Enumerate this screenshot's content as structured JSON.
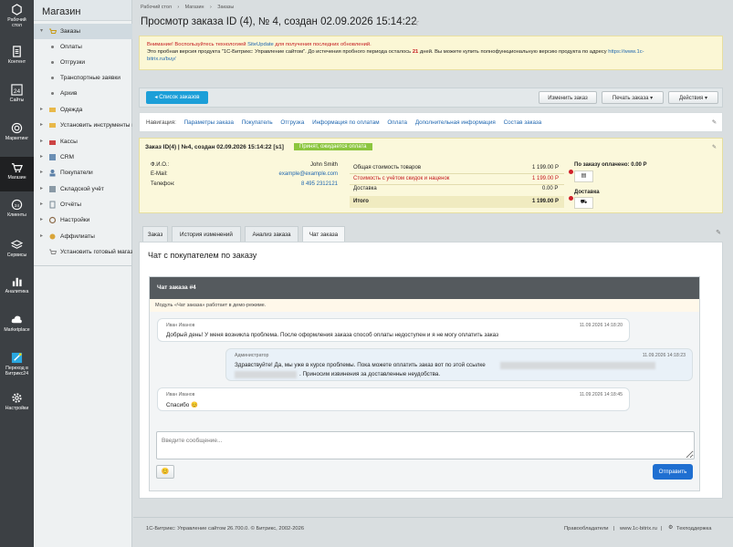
{
  "rail": [
    {
      "name": "desktop",
      "label": "Рабочий\nстол"
    },
    {
      "name": "content",
      "label": "Контент"
    },
    {
      "name": "sites",
      "label": "Сайты",
      "num": "24"
    },
    {
      "name": "marketing",
      "label": "Маркетинг"
    },
    {
      "name": "store",
      "label": "Магазин"
    },
    {
      "name": "clients",
      "label": "Клиенты"
    },
    {
      "name": "services",
      "label": "Сервисы"
    },
    {
      "name": "analytics",
      "label": "Аналитика"
    },
    {
      "name": "marketplace",
      "label": "Marketplace"
    },
    {
      "name": "bitrix24",
      "label": "Переход в\nБитрикс24"
    },
    {
      "name": "settings",
      "label": "Настройки"
    }
  ],
  "menu": {
    "title": "Магазин",
    "items": [
      "Заказы",
      "Оплаты",
      "Отгрузки",
      "Транспортные заявки",
      "Архив",
      "Одежда",
      "Установить инструменты и",
      "Кассы",
      "CRM",
      "Покупатели",
      "Складской учёт",
      "Отчёты",
      "Настройки",
      "Аффилиаты",
      "Установить готовый магазин"
    ]
  },
  "breadcrumbs": [
    "Рабочий стол",
    "Магазин",
    "Заказы"
  ],
  "title": "Просмотр заказа ID (4), № 4, создан 02.09.2026 15:14:22",
  "warning": {
    "line1_red": "Внимание! Воспользуйтесь технологией",
    "link1": "SiteUpdate",
    "line1_end": "для получения последних обновлений.",
    "line2a": "Это пробная версия продукта \"1С-Битрикс: Управление сайтом\". До истечения пробного периода осталось",
    "days": "21",
    "line2b": "дней. Вы можете купить полнофункциональную версию продукта по адресу",
    "link2": "https://www.1c-",
    "link3": "bitrix.ru/buy/"
  },
  "toolbar": {
    "list": "Список заказов",
    "edit": "Изменить заказ",
    "print": "Печать заказа",
    "actions": "Действия"
  },
  "nav": {
    "label": "Навигация:",
    "links": [
      "Параметры заказа",
      "Покупатель",
      "Отгрузка",
      "Информация по оплатам",
      "Оплата",
      "Дополнительная информация",
      "Состав заказа"
    ]
  },
  "order": {
    "header": "Заказ ID(4) | №4, создан 02.09.2026 15:14:22 [s1]",
    "status": "Принят, ожидается оплата",
    "fio_label": "Ф.И.О.:",
    "fio": "John Smith",
    "email_label": "E-Mail:",
    "email": "example@example.com",
    "phone_label": "Телефон:",
    "phone": "8 495 2312121",
    "total_goods_label": "Общая стоимость товаров",
    "total_goods": "1 199.00 Р",
    "discount_label": "Стоимость с учётом скидок и наценок",
    "discount": "1 199.00 Р",
    "delivery_label": "Доставка",
    "delivery": "0.00 Р",
    "total_label": "Итого",
    "total": "1 199.00 Р",
    "paid": "По заказу оплачено: 0.00 Р",
    "shipping": "Доставка"
  },
  "tabs": [
    "Заказ",
    "История изменений",
    "Анализ заказа",
    "Чат заказа"
  ],
  "chat": {
    "heading": "Чат с покупателем по заказу",
    "title": "Чат заказа #4",
    "demo": "Модуль «Чат заказа» работает в демо-режиме.",
    "messages": [
      {
        "author": "Иван Иванов",
        "time": "11.09.2026 14:18:20",
        "text": "Добрый день! У меня возникла проблема. После оформления заказа способ оплаты недоступен и я не могу оплатить заказ"
      },
      {
        "author": "Администратор",
        "time": "11.09.2026 14:18:23",
        "text1": "Здравствуйте! Да, мы уже в курсе проблемы. Пока можете оплатить заказ вот по этой ссылке",
        "text2": ". Приносим извинения за доставленные неудобства."
      },
      {
        "author": "Иван Иванов",
        "time": "11.09.2026 14:18:45",
        "text": "Спасибо 😊"
      }
    ],
    "placeholder": "Введите сообщение...",
    "emoji": "😊",
    "send": "Отправить"
  },
  "footer": {
    "copyright": "1С-Битрикс: Управление сайтом 26.700.0. © Битрикс, 2002-2026",
    "rights": "Правообладатели",
    "site": "www.1c-bitrix.ru",
    "support": "Техподдержка"
  }
}
